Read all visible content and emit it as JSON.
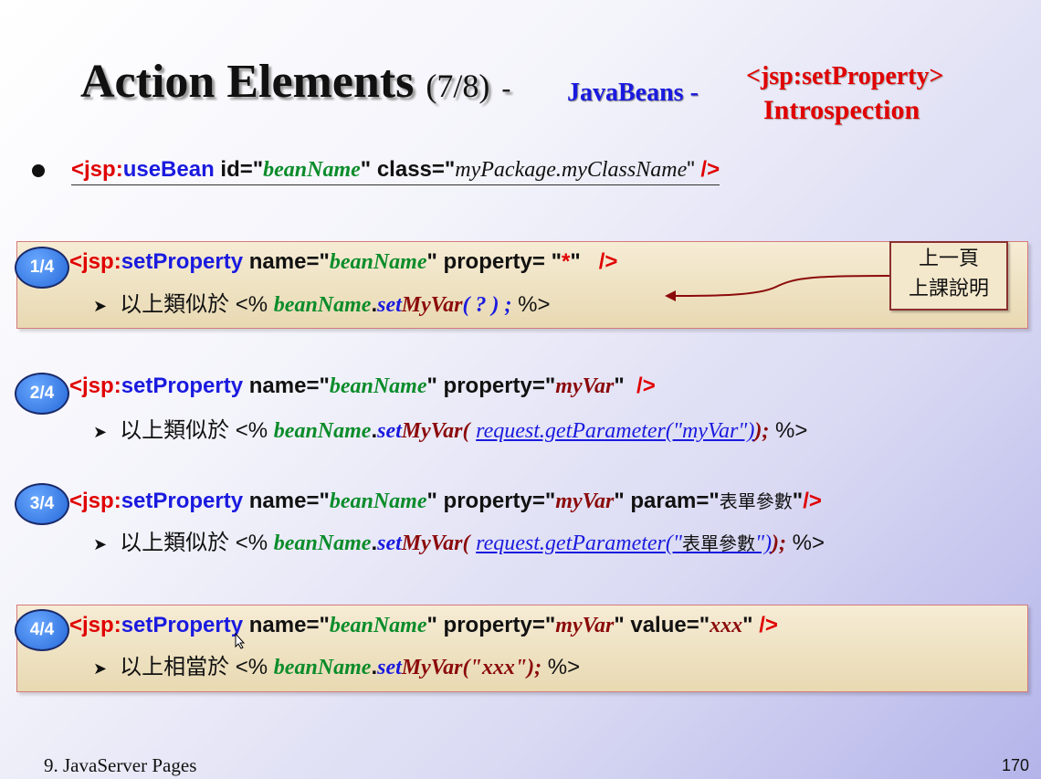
{
  "title": {
    "main": "Action Elements",
    "part": "(7/8)",
    "dash1": "-",
    "javabeans": "JavaBeans",
    "dash2": "-",
    "tag": "<jsp:setProperty>",
    "sub": "Introspection"
  },
  "usebean": {
    "open": "<jsp:",
    "tag": "useBean",
    "id_attr": " id=\"",
    "id_val": "beanName",
    "class_attr": "\" class=\"",
    "class_val": "myPackage.myClassName",
    "close_q": "\"",
    "end": " />"
  },
  "items": [
    {
      "badge": "1/4",
      "jsp": "<jsp:",
      "tag": "setProperty",
      "name_attr": " name=\"",
      "name_val": "beanName",
      "prop_attr": "\" property= \"",
      "prop_val": "*",
      "prop_close": "\"",
      "end": "/>",
      "prefix": "以上類似於 <% ",
      "bean": "beanName",
      "dot": ".",
      "set": "set",
      "myvar": "MyVar",
      "arg": "( ? ) ;",
      "suffix": " %>"
    },
    {
      "badge": "2/4",
      "jsp": "<jsp:",
      "tag": "setProperty",
      "name_attr": " name=\"",
      "name_val": "beanName",
      "prop_attr": "\" property=\"",
      "prop_val": "myVar",
      "prop_close": "\"",
      "end": "/>",
      "prefix": "以上類似於 <% ",
      "bean": "beanName",
      "dot": ".",
      "set": "set",
      "myvar": "MyVar",
      "open": "(",
      "call": "request.getParameter(\"myVar\")",
      "close": ");",
      "suffix": " %>"
    },
    {
      "badge": "3/4",
      "jsp": "<jsp:",
      "tag": "setProperty",
      "name_attr": " name=\"",
      "name_val": "beanName",
      "prop_attr": "\" property=\"",
      "prop_val": "myVar",
      "param_attr": "\" param=\"",
      "param_val": "表單參數",
      "param_close": "\"",
      "end": "/>",
      "prefix": "以上類似於 <% ",
      "bean": "beanName",
      "dot": ".",
      "set": "set",
      "myvar": "MyVar",
      "open": "(",
      "call_a": "request.getParameter(\"",
      "call_b": "表單參數",
      "call_c": "\")",
      "close": ");",
      "suffix": " %>"
    },
    {
      "badge": "4/4",
      "jsp": "<jsp:",
      "tag": "setProperty",
      "name_attr": " name=\"",
      "name_val": "beanName",
      "prop_attr": "\" property=\"",
      "prop_val": "myVar",
      "value_attr": "\" value=\"",
      "value_val": "xxx",
      "value_close": "\"",
      "end": "/>",
      "prefix": "以上相當於 <% ",
      "bean": "beanName",
      "dot": ".",
      "set": "set",
      "myvar": "MyVar",
      "arg_a": "(\"",
      "arg_b": "xxx",
      "arg_c": "\");",
      "suffix": " %>"
    }
  ],
  "note": {
    "line1": "上一頁",
    "line2": "上課說明"
  },
  "footer": {
    "left": "9. JavaServer Pages",
    "page": "170"
  },
  "colors": {
    "red": "#e00000",
    "blue": "#1a1adf",
    "green": "#0a8c2a",
    "maroon": "#8b0a0a",
    "badge": "#2468d8",
    "panel": "#efe2c3"
  }
}
